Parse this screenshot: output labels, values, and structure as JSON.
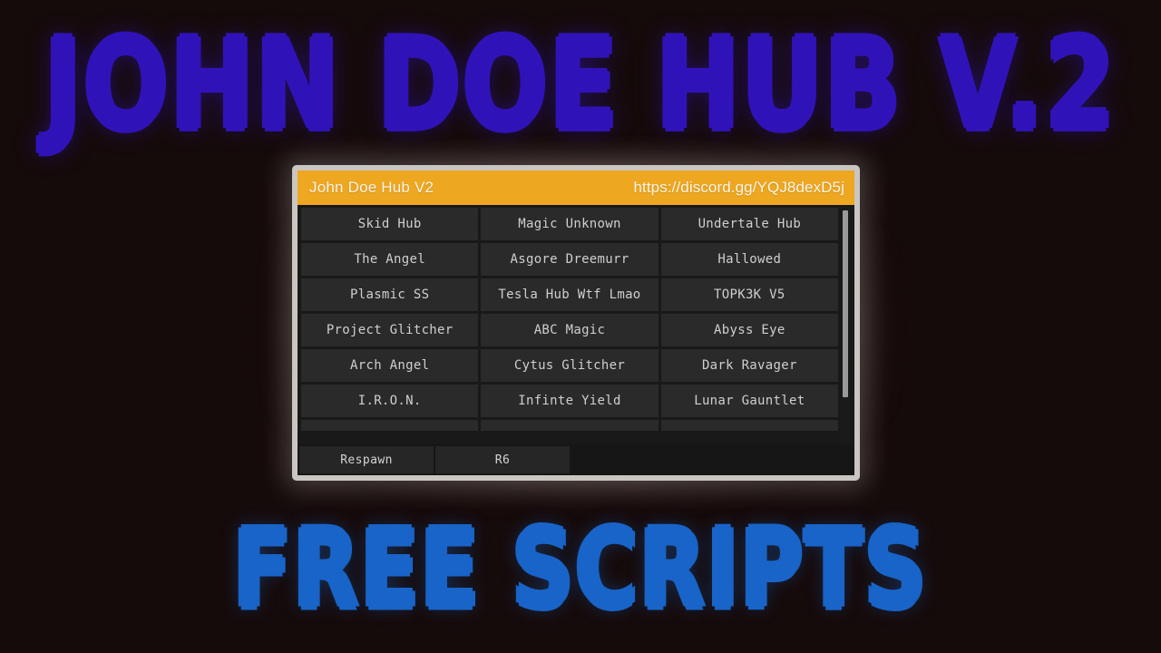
{
  "thumbnail": {
    "background_color": "#160b0b",
    "title_top": "JOHN DOE HUB V.2",
    "title_top_color": "#3013b8",
    "title_bottom": "FREE SCRIPTS",
    "title_bottom_color": "#1864c8"
  },
  "window": {
    "border_color": "#c9c6c2",
    "title_bar": {
      "background_color": "#eda720",
      "title": "John Doe Hub V2",
      "discord_link": "https://discord.gg/YQJ8dexD5j"
    },
    "scripts": [
      {
        "left": "Skid Hub",
        "middle": "Magic Unknown",
        "right": "Undertale Hub"
      },
      {
        "left": "The Angel",
        "middle": "Asgore Dreemurr",
        "right": "Hallowed"
      },
      {
        "left": "Plasmic SS",
        "middle": "Tesla Hub Wtf Lmao",
        "right": "TOPK3K V5"
      },
      {
        "left": "Project Glitcher",
        "middle": "ABC Magic",
        "right": "Abyss Eye"
      },
      {
        "left": "Arch Angel",
        "middle": "Cytus Glitcher",
        "right": "Dark Ravager"
      },
      {
        "left": "I.R.O.N.",
        "middle": "Infinte Yield",
        "right": "Lunar Gauntlet"
      }
    ],
    "actions": {
      "respawn_label": "Respawn",
      "rig_label": "R6"
    }
  }
}
